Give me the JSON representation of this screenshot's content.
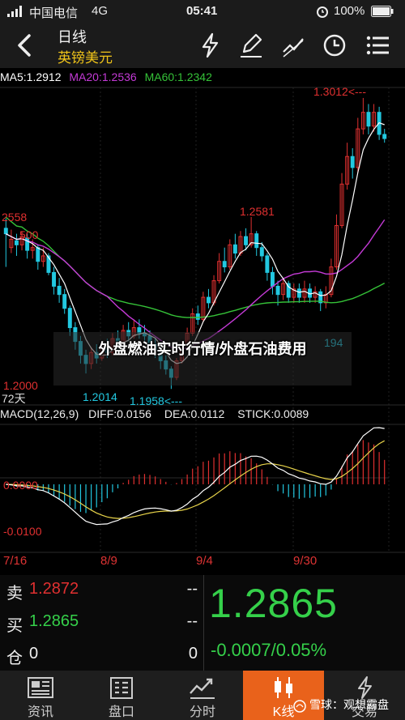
{
  "status_bar": {
    "carrier": "中国电信",
    "network": "4G",
    "time": "05:41",
    "battery": "100%"
  },
  "header": {
    "title": "日线",
    "subtitle": "英镑美元"
  },
  "ma_legend": {
    "ma5": "MA5:1.2912",
    "ma20": "MA20:1.2536",
    "ma60": "MA60:1.2342"
  },
  "macd_legend": {
    "name": "MACD(12,26,9)",
    "diff": "DIFF:0.0156",
    "dea": "DEA:0.0112",
    "stick": "STICK:0.0089"
  },
  "colors": {
    "up": "#e03030",
    "down": "#22c8e0",
    "ma5": "#ffffff",
    "ma20": "#c43ad6",
    "ma60": "#35c238",
    "dea": "#e8d44a",
    "axis": "#d33",
    "accent": "#e9621b",
    "green_text": "#35d04a"
  },
  "chart_data": {
    "type": "candlestick",
    "price_labels": {
      "top_left": "2558",
      "top_left_b": "500",
      "bottom_left": "1.2000",
      "period": "72天",
      "high_peak": "1.3012<---",
      "mid_peak": "1.2581",
      "low_a": "1.2014",
      "low_b": "1.1958<---",
      "right_low": "194"
    },
    "macd_labels": {
      "zero": "0.0000",
      "neg": "-0.0100"
    },
    "x_ticks": [
      "7/16",
      "8/9",
      "9/4",
      "9/30"
    ],
    "ylim": [
      1.19,
      1.305
    ],
    "candles": [
      [
        1.254,
        1.252,
        1.2575,
        1.24
      ],
      [
        1.247,
        1.25,
        1.2535,
        1.245
      ],
      [
        1.2495,
        1.248,
        1.252,
        1.244
      ],
      [
        1.248,
        1.251,
        1.253,
        1.246
      ],
      [
        1.2505,
        1.246,
        1.252,
        1.243
      ],
      [
        1.246,
        1.247,
        1.25,
        1.243
      ],
      [
        1.247,
        1.242,
        1.248,
        1.239
      ],
      [
        1.242,
        1.244,
        1.247,
        1.24
      ],
      [
        1.244,
        1.238,
        1.245,
        1.237
      ],
      [
        1.238,
        1.233,
        1.24,
        1.23
      ],
      [
        1.233,
        1.23,
        1.236,
        1.227
      ],
      [
        1.23,
        1.225,
        1.232,
        1.223
      ],
      [
        1.225,
        1.218,
        1.226,
        1.215
      ],
      [
        1.218,
        1.213,
        1.22,
        1.21
      ],
      [
        1.213,
        1.208,
        1.215,
        1.205
      ],
      [
        1.208,
        1.205,
        1.21,
        1.2014
      ],
      [
        1.205,
        1.209,
        1.211,
        1.203
      ],
      [
        1.209,
        1.207,
        1.212,
        1.205
      ],
      [
        1.207,
        1.211,
        1.213,
        1.206
      ],
      [
        1.211,
        1.209,
        1.214,
        1.207
      ],
      [
        1.209,
        1.214,
        1.216,
        1.208
      ],
      [
        1.214,
        1.212,
        1.217,
        1.21
      ],
      [
        1.212,
        1.217,
        1.219,
        1.211
      ],
      [
        1.217,
        1.215,
        1.22,
        1.213
      ],
      [
        1.215,
        1.218,
        1.221,
        1.214
      ],
      [
        1.218,
        1.216,
        1.221,
        1.214
      ],
      [
        1.216,
        1.215,
        1.219,
        1.213
      ],
      [
        1.215,
        1.212,
        1.217,
        1.21
      ],
      [
        1.212,
        1.21,
        1.214,
        1.207
      ],
      [
        1.21,
        1.206,
        1.211,
        1.203
      ],
      [
        1.206,
        1.203,
        1.208,
        1.201
      ],
      [
        1.203,
        1.2,
        1.204,
        1.1958
      ],
      [
        1.2,
        1.206,
        1.207,
        1.199
      ],
      [
        1.206,
        1.212,
        1.213,
        1.205
      ],
      [
        1.212,
        1.216,
        1.218,
        1.211
      ],
      [
        1.216,
        1.223,
        1.225,
        1.215
      ],
      [
        1.223,
        1.221,
        1.226,
        1.219
      ],
      [
        1.221,
        1.229,
        1.231,
        1.22
      ],
      [
        1.229,
        1.227,
        1.232,
        1.225
      ],
      [
        1.227,
        1.235,
        1.237,
        1.226
      ],
      [
        1.235,
        1.242,
        1.245,
        1.234
      ],
      [
        1.242,
        1.24,
        1.247,
        1.238
      ],
      [
        1.24,
        1.248,
        1.25,
        1.239
      ],
      [
        1.248,
        1.245,
        1.252,
        1.243
      ],
      [
        1.245,
        1.251,
        1.253,
        1.244
      ],
      [
        1.251,
        1.248,
        1.254,
        1.246
      ],
      [
        1.248,
        1.252,
        1.2581,
        1.247
      ],
      [
        1.252,
        1.247,
        1.253,
        1.244
      ],
      [
        1.247,
        1.244,
        1.249,
        1.242
      ],
      [
        1.244,
        1.238,
        1.245,
        1.235
      ],
      [
        1.238,
        1.233,
        1.24,
        1.23
      ],
      [
        1.233,
        1.23,
        1.235,
        1.226
      ],
      [
        1.23,
        1.234,
        1.236,
        1.228
      ],
      [
        1.234,
        1.229,
        1.235,
        1.227
      ],
      [
        1.229,
        1.232,
        1.234,
        1.227
      ],
      [
        1.232,
        1.229,
        1.234,
        1.227
      ],
      [
        1.229,
        1.232,
        1.235,
        1.227
      ],
      [
        1.232,
        1.229,
        1.234,
        1.227
      ],
      [
        1.229,
        1.231,
        1.233,
        1.227
      ],
      [
        1.231,
        1.227,
        1.232,
        1.224
      ],
      [
        1.227,
        1.23,
        1.233,
        1.225
      ],
      [
        1.23,
        1.24,
        1.243,
        1.229
      ],
      [
        1.24,
        1.255,
        1.259,
        1.239
      ],
      [
        1.255,
        1.27,
        1.274,
        1.254
      ],
      [
        1.27,
        1.28,
        1.285,
        1.268
      ],
      [
        1.28,
        1.276,
        1.283,
        1.272
      ],
      [
        1.276,
        1.29,
        1.294,
        1.274
      ],
      [
        1.29,
        1.296,
        1.3012,
        1.288
      ],
      [
        1.296,
        1.291,
        1.299,
        1.288
      ],
      [
        1.291,
        1.296,
        1.299,
        1.289
      ],
      [
        1.296,
        1.288,
        1.298,
        1.286
      ],
      [
        1.288,
        1.2865,
        1.29,
        1.285
      ]
    ]
  },
  "quote": {
    "sell_label": "卖",
    "sell_value": "1.2872",
    "sell_qty": "--",
    "buy_label": "买",
    "buy_value": "1.2865",
    "buy_qty": "--",
    "pos_label": "仓",
    "pos_value": "0",
    "pos_right": "0",
    "price": "1.2865",
    "change": "-0.0007/0.05%"
  },
  "tabs": [
    {
      "label": "资讯",
      "icon": "news-icon"
    },
    {
      "label": "盘口",
      "icon": "orderbook-icon"
    },
    {
      "label": "分时",
      "icon": "timeshare-icon"
    },
    {
      "label": "K线",
      "icon": "candlestick-icon"
    },
    {
      "label": "交易",
      "icon": "trade-icon"
    }
  ],
  "overlay": {
    "text": "外盘燃油实时行情/外盘石油费用"
  },
  "watermark": {
    "text": "雪球：观想霸盘"
  }
}
